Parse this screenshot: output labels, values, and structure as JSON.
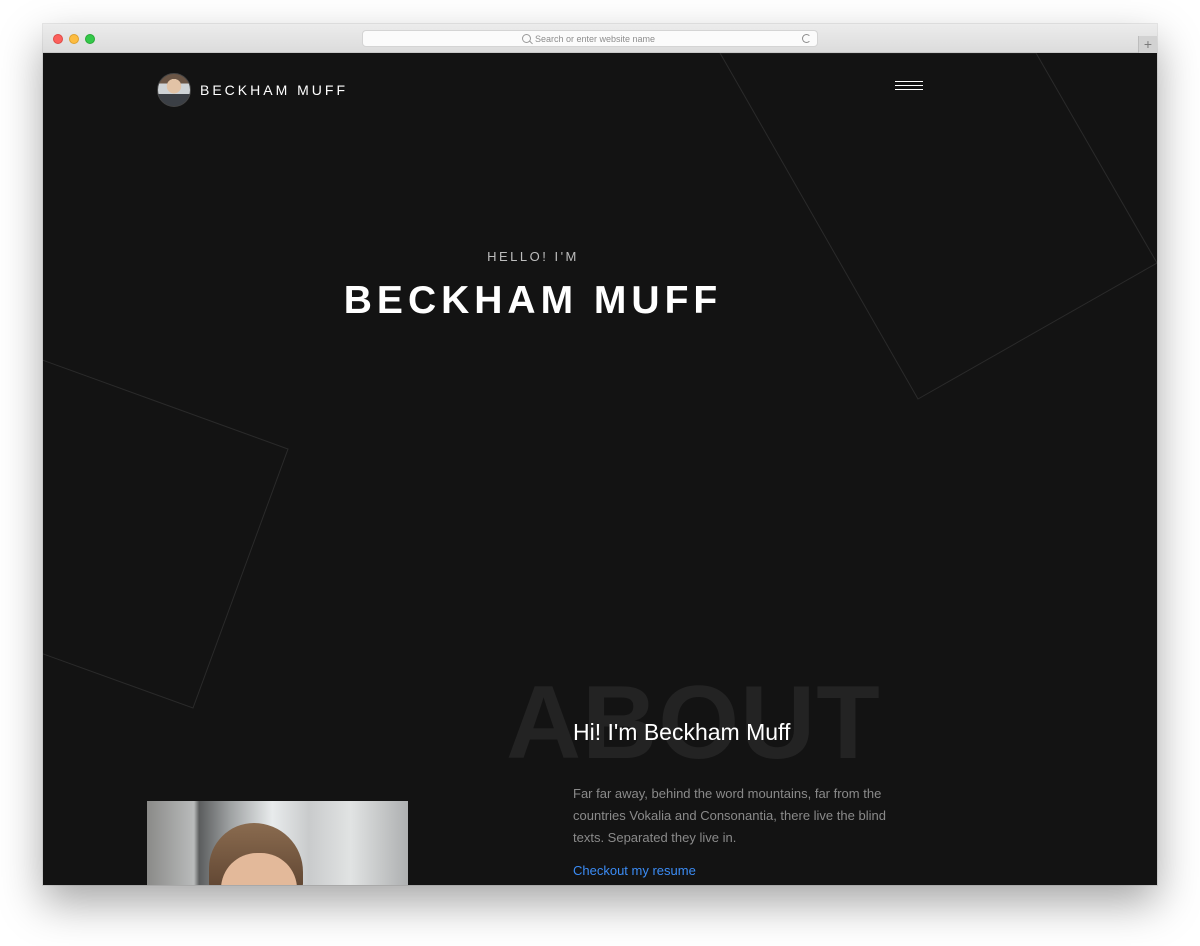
{
  "browser": {
    "address_placeholder": "Search or enter website name",
    "new_tab_symbol": "+"
  },
  "site": {
    "brand_name": "BECKHAM MUFF",
    "menu_icon": "hamburger-menu-icon"
  },
  "hero": {
    "kicker": "HELLO! I'M",
    "title": "BECKHAM MUFF"
  },
  "about": {
    "ghost_word": "ABOUT",
    "heading": "Hi! I'm Beckham Muff",
    "text": "Far far away, behind the word mountains, far from the countries Vokalia and Consonantia, there live the blind texts. Separated they live in.",
    "resume_link": "Checkout my resume"
  },
  "colors": {
    "background": "#131313",
    "accent_link": "#3b8cf5",
    "decor_lines": "#2a2a2a"
  }
}
